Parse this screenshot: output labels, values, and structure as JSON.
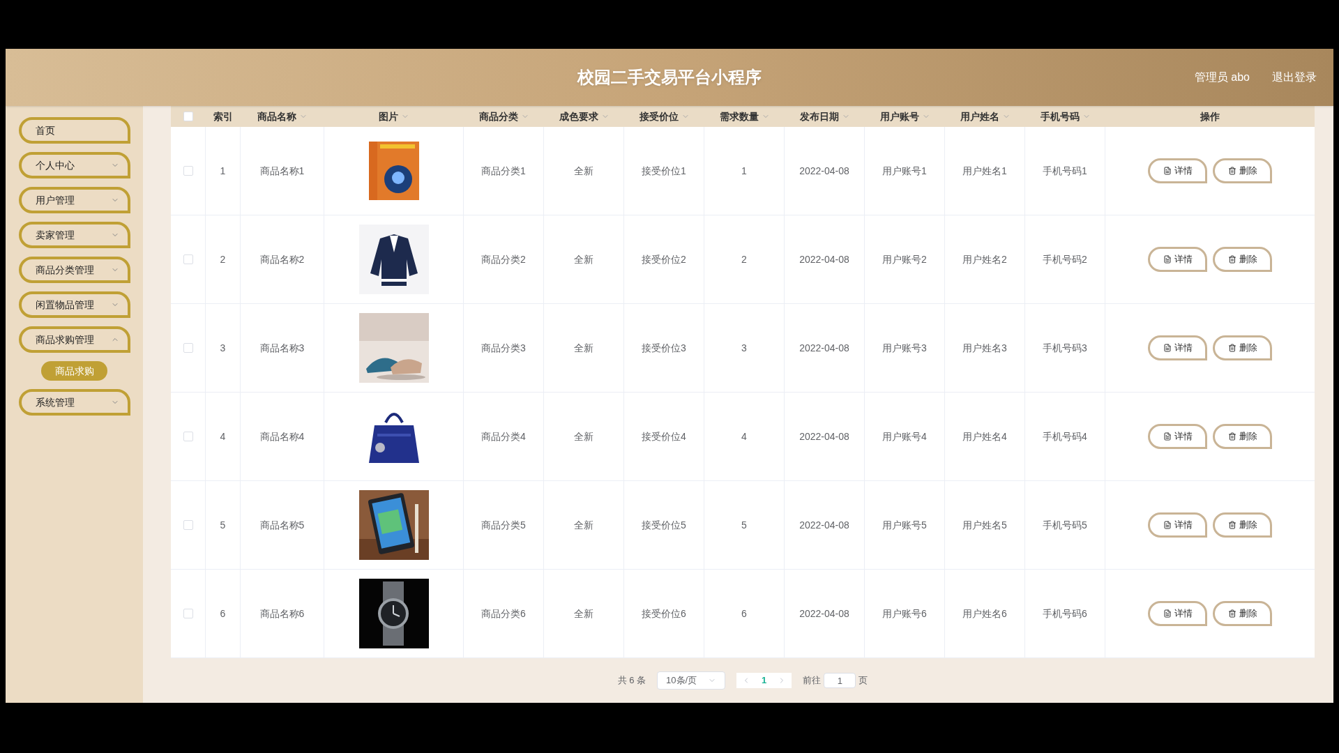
{
  "header": {
    "title": "校园二手交易平台小程序",
    "user": "管理员 abo",
    "logout": "退出登录"
  },
  "sidebar": {
    "items": [
      {
        "label": "首页",
        "kind": "link"
      },
      {
        "label": "个人中心",
        "kind": "group",
        "expanded": false
      },
      {
        "label": "用户管理",
        "kind": "group",
        "expanded": false
      },
      {
        "label": "卖家管理",
        "kind": "group",
        "expanded": false
      },
      {
        "label": "商品分类管理",
        "kind": "group",
        "expanded": false
      },
      {
        "label": "闲置物品管理",
        "kind": "group",
        "expanded": false
      },
      {
        "label": "商品求购管理",
        "kind": "group",
        "expanded": true,
        "children": [
          {
            "label": "商品求购"
          }
        ]
      },
      {
        "label": "系统管理",
        "kind": "group",
        "expanded": false
      }
    ]
  },
  "table": {
    "select_all_checked": false,
    "columns": [
      "索引",
      "商品名称",
      "图片",
      "商品分类",
      "成色要求",
      "接受价位",
      "需求数量",
      "发布日期",
      "用户账号",
      "用户姓名",
      "手机号码",
      "操作"
    ],
    "rows": [
      {
        "checked": false,
        "cells": [
          "1",
          "商品名称1",
          {
            "kind": "picture"
          },
          "商品分类1",
          "全新",
          "接受价位1",
          "1",
          "2022-04-08",
          "用户账号1",
          "用户姓名1",
          "手机号码1"
        ],
        "actions": [
          "详情",
          "删除"
        ]
      },
      {
        "checked": false,
        "cells": [
          "2",
          "商品名称2",
          {
            "kind": "picture"
          },
          "商品分类2",
          "全新",
          "接受价位2",
          "2",
          "2022-04-08",
          "用户账号2",
          "用户姓名2",
          "手机号码2"
        ],
        "actions": [
          "详情",
          "删除"
        ]
      },
      {
        "checked": false,
        "cells": [
          "3",
          "商品名称3",
          {
            "kind": "picture"
          },
          "商品分类3",
          "全新",
          "接受价位3",
          "3",
          "2022-04-08",
          "用户账号3",
          "用户姓名3",
          "手机号码3"
        ],
        "actions": [
          "详情",
          "删除"
        ]
      },
      {
        "checked": false,
        "cells": [
          "4",
          "商品名称4",
          {
            "kind": "picture"
          },
          "商品分类4",
          "全新",
          "接受价位4",
          "4",
          "2022-04-08",
          "用户账号4",
          "用户姓名4",
          "手机号码4"
        ],
        "actions": [
          "详情",
          "删除"
        ]
      },
      {
        "checked": false,
        "cells": [
          "5",
          "商品名称5",
          {
            "kind": "picture"
          },
          "商品分类5",
          "全新",
          "接受价位5",
          "5",
          "2022-04-08",
          "用户账号5",
          "用户姓名5",
          "手机号码5"
        ],
        "actions": [
          "详情",
          "删除"
        ]
      },
      {
        "checked": false,
        "cells": [
          "6",
          "商品名称6",
          {
            "kind": "picture"
          },
          "商品分类6",
          "全新",
          "接受价位6",
          "6",
          "2022-04-08",
          "用户账号6",
          "用户姓名6",
          "手机号码6"
        ],
        "actions": [
          "详情",
          "删除"
        ]
      }
    ]
  },
  "pagination": {
    "total": "共 6 条",
    "page_size": "10条/页",
    "pages": [
      {
        "label": "1",
        "selected": true
      }
    ],
    "goto_label": "前往",
    "goto_value": "1",
    "goto_suffix": "页"
  }
}
